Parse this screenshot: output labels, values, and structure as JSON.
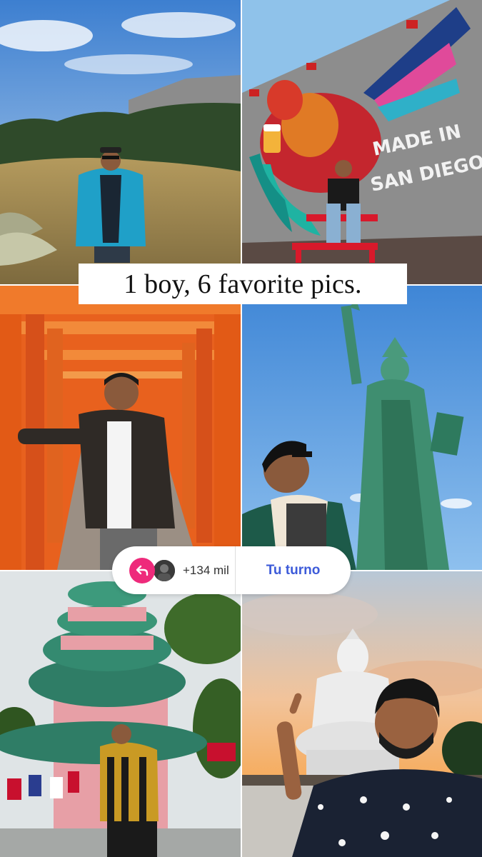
{
  "caption": "1 boy, 6 favorite pics.",
  "mural_text": {
    "line1": "MADE IN",
    "line2": "SAN DIEGO"
  },
  "share_pill": {
    "reply_icon": "reply-arrow-icon",
    "count": "+134 mil",
    "action_label": "Tu turno"
  },
  "photos": [
    "mountain-meadow",
    "made-in-san-diego-mural",
    "torii-gates",
    "statue-of-liberty",
    "dragon-temple",
    "big-buddha"
  ],
  "colors": {
    "reply_badge": "#ee2a7b",
    "action_text": "#3d5bd9",
    "torii_orange": "#e8611e"
  }
}
